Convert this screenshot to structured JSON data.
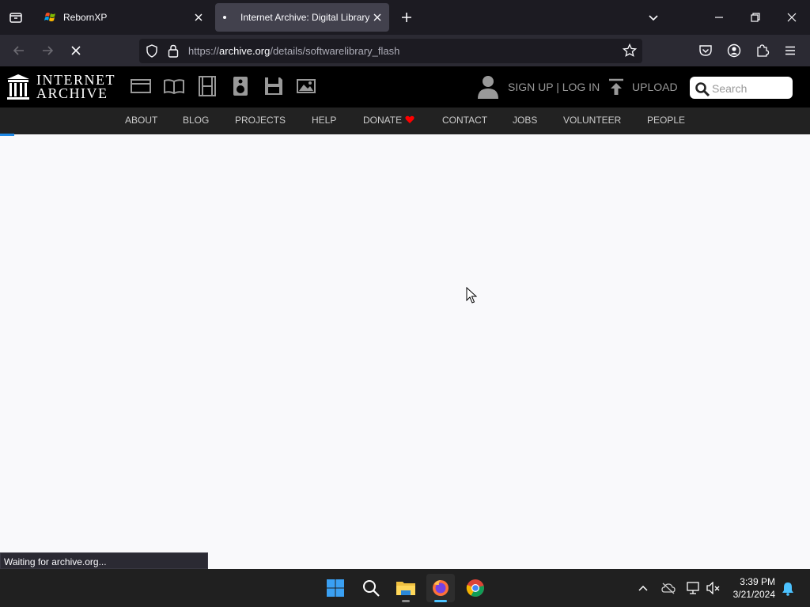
{
  "browser": {
    "tabs": [
      {
        "title": "RebornXP",
        "active": false
      },
      {
        "title": "Internet Archive: Digital Library",
        "active": true
      }
    ],
    "url": {
      "prefix": "https://",
      "host": "archive.org",
      "path": "/details/softwarelibrary_flash"
    },
    "status_text": "Waiting for archive.org..."
  },
  "ia_header": {
    "logo_line1": "INTERNET",
    "logo_line2": "ARCHIVE",
    "signup_login": "SIGN UP | LOG IN",
    "upload": "UPLOAD",
    "search_placeholder": "Search",
    "nav": [
      "ABOUT",
      "BLOG",
      "PROJECTS",
      "HELP",
      "DONATE",
      "CONTACT",
      "JOBS",
      "VOLUNTEER",
      "PEOPLE"
    ]
  },
  "taskbar": {
    "time": "3:39 PM",
    "date": "3/21/2024"
  },
  "colors": {
    "accent": "#1e88e5",
    "donate_heart": "#ff0000",
    "tab_active": "#42414d"
  }
}
